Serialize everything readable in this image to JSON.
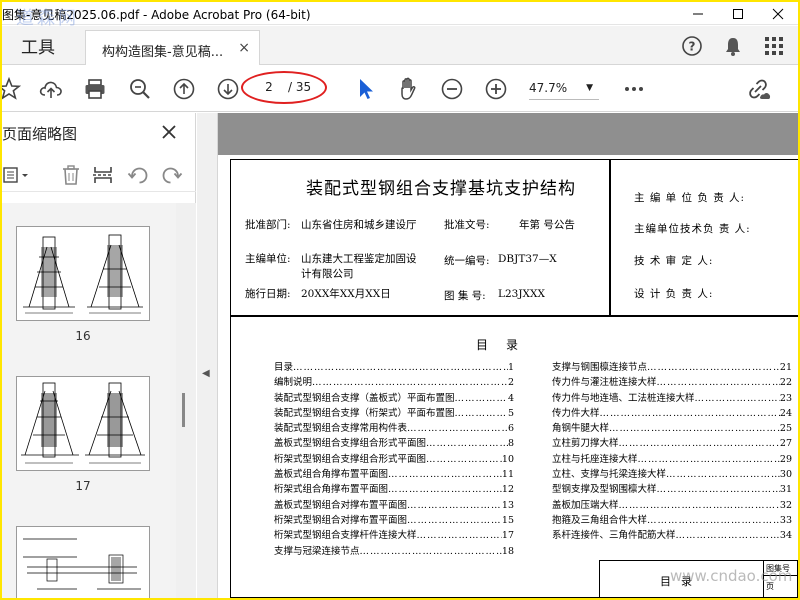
{
  "window": {
    "title": "图集-意见稿2025.06.pdf - Adobe Acrobat Pro (64-bit)",
    "watermark": "道森网"
  },
  "tabs": {
    "tools_label": "工具",
    "document_tab_label": "构构造图集-意见稿...",
    "close_glyph": "×"
  },
  "toolbar": {
    "current_page": "2",
    "total_pages": "/ 35",
    "zoom_value": "47.7%"
  },
  "left_panel": {
    "title": "页面缩略图",
    "thumbnails": [
      {
        "label": "16"
      },
      {
        "label": "17"
      }
    ]
  },
  "document": {
    "main_title": "装配式型钢组合支撑基坑支护结构",
    "approval_dept_label": "批准部门:",
    "approval_dept_value": "山东省住房和城乡建设厅",
    "approval_doc_label": "批准文号:",
    "approval_doc_value": "年第   号公告",
    "editor_label": "主编单位:",
    "editor_value_line1": "山东建大工程鉴定加固设",
    "editor_value_line2": "计有限公司",
    "unified_no_label": "统一编号:",
    "unified_no_value": "DBJT37—X",
    "impl_date_label": "施行日期:",
    "impl_date_value": "20XX年XX月XX日",
    "atlas_no_label": "图 集 号:",
    "atlas_no_value": "L23JXXX",
    "roles": [
      "主 编 单 位 负 责 人:",
      "主编单位技术负 责 人:",
      "技   术   审   定   人:",
      "设   计   负   责   人:"
    ],
    "toc_title": "目录",
    "toc_left": [
      {
        "title": "目录",
        "page": "1"
      },
      {
        "title": "编制说明",
        "page": "2"
      },
      {
        "title": "装配式型钢组合支撑（盖板式）平面布置图",
        "page": "4"
      },
      {
        "title": "装配式型钢组合支撑（桁架式）平面布置图",
        "page": "5"
      },
      {
        "title": "装配式型钢组合支撑常用构件表",
        "page": "6"
      },
      {
        "title": "盖板式型钢组合支撑组合形式平面图",
        "page": "8"
      },
      {
        "title": "桁架式型钢组合支撑组合形式平面图",
        "page": "10"
      },
      {
        "title": "盖板式组合角撑布置平面图",
        "page": "11"
      },
      {
        "title": "桁架式组合角撑布置平面图",
        "page": "12"
      },
      {
        "title": "盖板式型钢组合对撑布置平面图",
        "page": "13"
      },
      {
        "title": "桁架式型钢组合对撑布置平面图",
        "page": "15"
      },
      {
        "title": "桁架式型钢组合支撑杆件连接大样",
        "page": "17"
      },
      {
        "title": "支撑与冠梁连接节点",
        "page": "18"
      }
    ],
    "toc_right": [
      {
        "title": "支撑与钢围檩连接节点",
        "page": "21"
      },
      {
        "title": "传力件与灌注桩连接大样",
        "page": "22"
      },
      {
        "title": "传力件与地连墙、工法桩连接大样",
        "page": "23"
      },
      {
        "title": "传力件大样",
        "page": "24"
      },
      {
        "title": "角钢牛腿大样",
        "page": "25"
      },
      {
        "title": "立柱剪刀撑大样",
        "page": "27"
      },
      {
        "title": "立柱与托座连接大样",
        "page": "29"
      },
      {
        "title": "立柱、支撑与托梁连接大样",
        "page": "30"
      },
      {
        "title": "型钢支撑及型钢围檩大样",
        "page": "31"
      },
      {
        "title": "盖板加压端大样",
        "page": "32"
      },
      {
        "title": "抱箍及三角组合件大样",
        "page": "33"
      },
      {
        "title": "系杆连接件、三角件配筋大样",
        "page": "34"
      }
    ],
    "titleblock_label": "目录",
    "titleblock_small1": "图集号",
    "titleblock_small2": "页",
    "watermark_url": "www.cndao.com"
  },
  "colors": {
    "annotation_circle": "#e02020",
    "acrobat_blue": "#1a5fd6",
    "screen_border": "#ffe600"
  }
}
